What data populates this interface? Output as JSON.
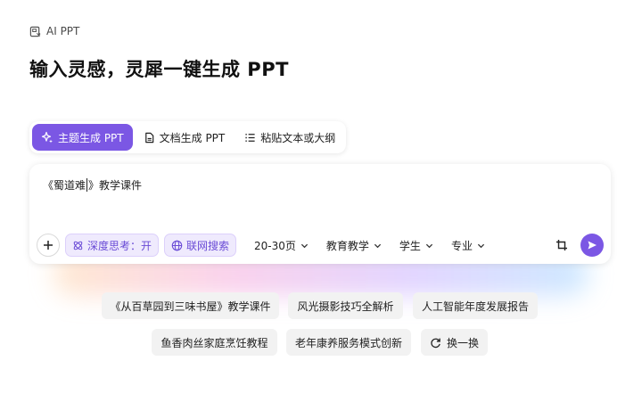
{
  "breadcrumb": {
    "label": "AI PPT",
    "icon": "ppt-doc-icon"
  },
  "headline": "输入灵感，灵犀一键生成 PPT",
  "tabs": [
    {
      "label": "主题生成 PPT",
      "icon": "sparkle-icon",
      "active": true
    },
    {
      "label": "文档生成 PPT",
      "icon": "document-icon",
      "active": false
    },
    {
      "label": "粘贴文本或大纲",
      "icon": "list-icon",
      "active": false
    }
  ],
  "input": {
    "before_cursor": "《蜀道难",
    "after_cursor": "》教学课件"
  },
  "toolbar": {
    "deep_think": "深度思考：开",
    "web_search": "联网搜索",
    "pages": "20-30页",
    "scene": "教育教学",
    "audience": "学生",
    "style": "专业"
  },
  "accent_color": "#7b57e4",
  "suggestions": [
    "《从百草园到三味书屋》教学课件",
    "风光摄影技巧全解析",
    "人工智能年度发展报告",
    "鱼香肉丝家庭烹饪教程",
    "老年康养服务模式创新"
  ],
  "refresh_label": "换一换"
}
